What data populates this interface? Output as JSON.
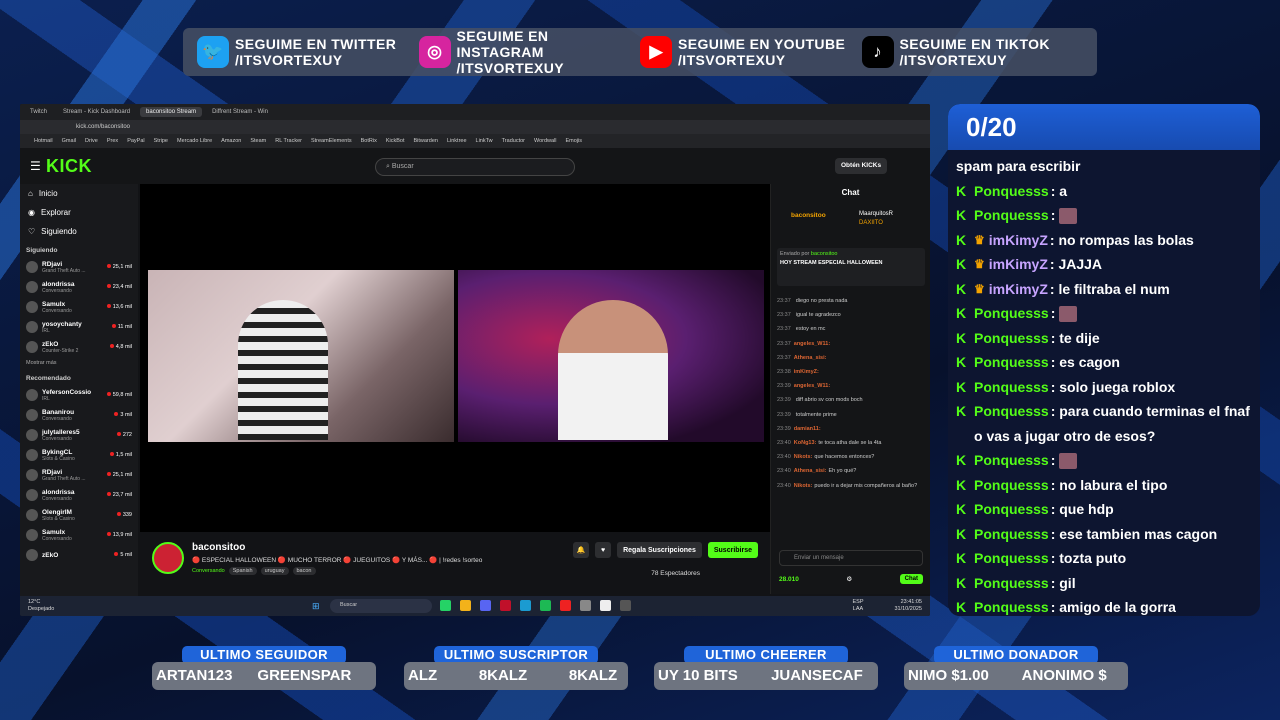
{
  "social": [
    {
      "icon": "twitter-icon",
      "line1": "SEGUIME EN TWITTER",
      "line2": "/ITSVORTEXUY",
      "color": "#1da1f2"
    },
    {
      "icon": "instagram-icon",
      "line1": "SEGUIME EN INSTAGRAM",
      "line2": "/ITSVORTEXUY",
      "color": "#d6249f"
    },
    {
      "icon": "youtube-icon",
      "line1": "SEGUIME EN YOUTUBE",
      "line2": "/ITSVORTEXUY",
      "color": "#ff0000"
    },
    {
      "icon": "tiktok-icon",
      "line1": "SEGUIME EN TIKTOK",
      "line2": "/ITSVORTEXUY",
      "color": "#000000"
    }
  ],
  "browser": {
    "tabs": [
      "Twitch",
      "Stream - Kick Dashboard",
      "baconsitoo Stream",
      "Diffrent Stream - Win"
    ],
    "url": "kick.com/baconsitoo",
    "bookmarks": [
      "Hotmail",
      "Gmail",
      "Drive",
      "Prex",
      "PayPal",
      "Stripe",
      "Mercado Libre",
      "Amazon",
      "Steam",
      "RL Tracker",
      "StreamElements",
      "BotRix",
      "KickBot",
      "Bitwarden",
      "Linktree",
      "LinkTw",
      "Traductor",
      "Wordwall",
      "Emojis"
    ]
  },
  "kick": {
    "logo": "KICK",
    "search_placeholder": "Buscar",
    "kicks_button": "Obtén KICKs",
    "nav": [
      "Inicio",
      "Explorar",
      "Siguiendo"
    ],
    "following_header": "Siguiendo",
    "following": [
      {
        "name": "RDjavi",
        "cat": "Grand Theft Auto ...",
        "viewers": "25,1 mil"
      },
      {
        "name": "alondrissa",
        "cat": "Conversando",
        "viewers": "23,4 mil"
      },
      {
        "name": "Samulx",
        "cat": "Conversando",
        "viewers": "13,6 mil"
      },
      {
        "name": "yosoychanty",
        "cat": "IRL",
        "viewers": "11 mil"
      },
      {
        "name": "zEkO",
        "cat": "Counter-Strike 2",
        "viewers": "4,8 mil"
      }
    ],
    "show_more": "Mostrar más",
    "recommended_header": "Recomendado",
    "recommended": [
      {
        "name": "YefersonCossio",
        "cat": "IRL",
        "viewers": "59,8 mil"
      },
      {
        "name": "Bananirou",
        "cat": "Conversando",
        "viewers": "3 mil"
      },
      {
        "name": "julytalleres5",
        "cat": "Conversando",
        "viewers": "272"
      },
      {
        "name": "BykingCL",
        "cat": "Slots & Casino",
        "viewers": "1,5 mil"
      },
      {
        "name": "RDjavi",
        "cat": "Grand Theft Auto ...",
        "viewers": "25,1 mil"
      },
      {
        "name": "alondrissa",
        "cat": "Conversando",
        "viewers": "23,7 mil"
      },
      {
        "name": "OlengirlM",
        "cat": "Slots & Casino",
        "viewers": "339"
      },
      {
        "name": "Samulx",
        "cat": "Conversando",
        "viewers": "13,9 mil"
      },
      {
        "name": "zEkO",
        "cat": "",
        "viewers": "5 mil"
      }
    ],
    "stream": {
      "name": "baconsitoo",
      "title": "🔴 ESPECIAL HALLOWEEN 🔴 MUCHO TERROR 🔴 JUEGUITOS 🔴 Y MÁS... 🔴 | !redes !sorteo",
      "category": "Conversando",
      "tags": [
        "Spanish",
        "uruguay",
        "bacon"
      ],
      "regala": "Regala Suscripciones",
      "subscribe": "Suscribirse",
      "viewers": "78 Espectadores"
    },
    "chat": {
      "title": "Chat",
      "top_user": "baconsitoo",
      "top_users2": [
        "MaarquitosR",
        "DAXIITO"
      ],
      "pinned_by": "Enviado por",
      "pinned_user": "baconsitoo",
      "pinned_text": "HOY STREAM ESPECIAL HALLOWEEN",
      "messages": [
        {
          "t": "23:37",
          "u": "",
          "m": "diego no presta nada"
        },
        {
          "t": "23:37",
          "u": "",
          "m": "igual te agradezco"
        },
        {
          "t": "23:37",
          "u": "",
          "m": "estoy en mc"
        },
        {
          "t": "23:37",
          "u": "angeles_W11:",
          "m": ""
        },
        {
          "t": "23:37",
          "u": "Athena_sisi:",
          "m": ""
        },
        {
          "t": "23:38",
          "u": "imKimyZ:",
          "m": ""
        },
        {
          "t": "23:39",
          "u": "angeles_W11:",
          "m": ""
        },
        {
          "t": "23:39",
          "u": "",
          "m": "diff abrio sv con mods boch"
        },
        {
          "t": "23:39",
          "u": "",
          "m": "totalmente prime"
        },
        {
          "t": "23:39",
          "u": "damian11:",
          "m": ""
        },
        {
          "t": "23:40",
          "u": "KoNg13:",
          "m": "te toca atha dale se la 4ta"
        },
        {
          "t": "23:40",
          "u": "Nikots:",
          "m": "que hacemos entonces?"
        },
        {
          "t": "23:40",
          "u": "Athena_sisi:",
          "m": "Eh yo qué?"
        },
        {
          "t": "23:40",
          "u": "Nikots:",
          "m": "puedo ir a dejar mis compañeros al baño?"
        }
      ],
      "input_placeholder": "Enviar un mensaje",
      "points": "28.010",
      "send": "Chat"
    }
  },
  "taskbar": {
    "temp": "12°C",
    "weather": "Despejado",
    "search": "Buscar",
    "lang": "ESP LAA",
    "time": "23:41:05",
    "date": "31/10/2025"
  },
  "overlay_chat": {
    "counter": "0/20",
    "intro": "spam para escribir",
    "messages": [
      {
        "user": "Ponquesss",
        "text": ": a",
        "crown": false,
        "emote": false
      },
      {
        "user": "Ponquesss",
        "text": ":",
        "crown": false,
        "emote": true
      },
      {
        "user": "imKimyZ",
        "text": ": no rompas las bolas",
        "crown": true,
        "emote": false
      },
      {
        "user": "imKimyZ",
        "text": ": JAJJA",
        "crown": true,
        "emote": false
      },
      {
        "user": "imKimyZ",
        "text": ": le filtraba el num",
        "crown": true,
        "emote": false
      },
      {
        "user": "Ponquesss",
        "text": ":",
        "crown": false,
        "emote": true
      },
      {
        "user": "Ponquesss",
        "text": ": te dije",
        "crown": false,
        "emote": false
      },
      {
        "user": "Ponquesss",
        "text": ": es cagon",
        "crown": false,
        "emote": false
      },
      {
        "user": "Ponquesss",
        "text": ": solo juega roblox",
        "crown": false,
        "emote": false
      },
      {
        "user": "Ponquesss",
        "text": ": para cuando terminas el fnaf o vas a jugar otro de esos?",
        "crown": false,
        "emote": false
      },
      {
        "user": "Ponquesss",
        "text": ":",
        "crown": false,
        "emote": true
      },
      {
        "user": "Ponquesss",
        "text": ": no labura el tipo",
        "crown": false,
        "emote": false
      },
      {
        "user": "Ponquesss",
        "text": ": que hdp",
        "crown": false,
        "emote": false
      },
      {
        "user": "Ponquesss",
        "text": ": ese tambien mas cagon",
        "crown": false,
        "emote": false
      },
      {
        "user": "Ponquesss",
        "text": ": tozta puto",
        "crown": false,
        "emote": false
      },
      {
        "user": "Ponquesss",
        "text": ": gil",
        "crown": false,
        "emote": false
      },
      {
        "user": "Ponquesss",
        "text": ": amigo de la gorra",
        "crown": false,
        "emote": false
      }
    ]
  },
  "bottom": [
    {
      "label": "ULTIMO SEGUIDOR",
      "value": "ARTAN123      GREENSPAR"
    },
    {
      "label": "ULTIMO SUSCRIPTOR",
      "value": "ALZ          8KALZ          8KALZ"
    },
    {
      "label": "ULTIMO CHEERER",
      "value": "UY 10 BITS        JUANSECAF"
    },
    {
      "label": "ULTIMO DONADOR",
      "value": "NIMO $1.00        ANONIMO $"
    }
  ]
}
